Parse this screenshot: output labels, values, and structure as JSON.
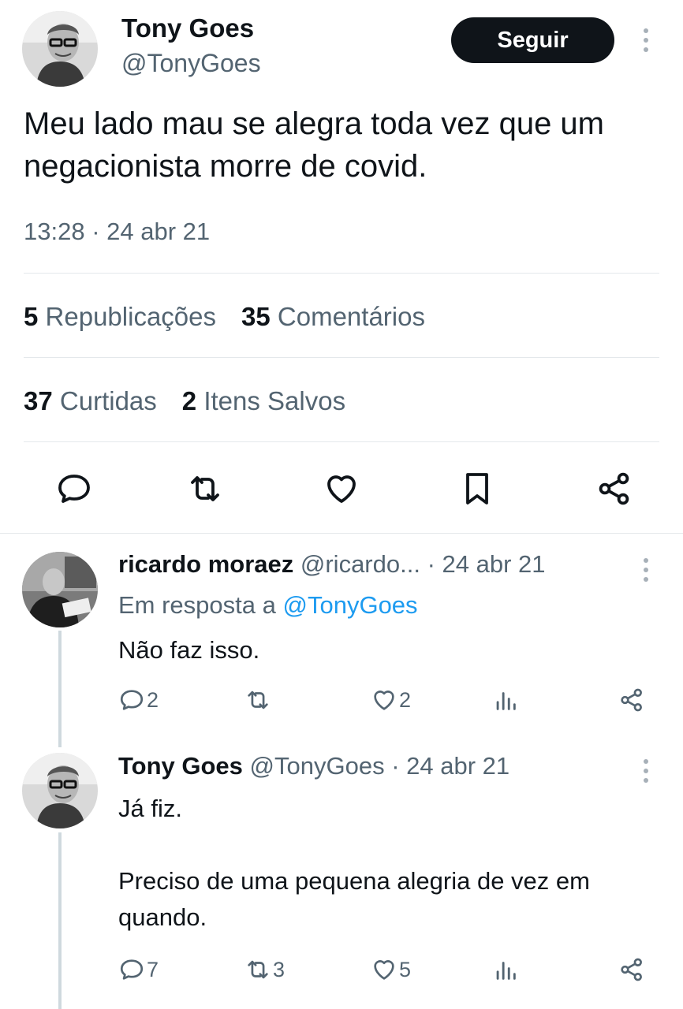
{
  "main_tweet": {
    "author_name": "Tony Goes",
    "author_handle": "@TonyGoes",
    "follow_label": "Seguir",
    "text": "Meu lado mau se alegra toda vez que um negacionista morre de covid.",
    "timestamp": "13:28 · 24 abr 21",
    "stats": {
      "reposts_count": "5",
      "reposts_label": "Republicações",
      "comments_count": "35",
      "comments_label": "Comentários",
      "likes_count": "37",
      "likes_label": "Curtidas",
      "saves_count": "2",
      "saves_label": "Itens Salvos"
    },
    "actions": [
      "reply-icon",
      "retweet-icon",
      "heart-icon",
      "bookmark-icon",
      "share-icon"
    ]
  },
  "replies": [
    {
      "name": "ricardo moraez",
      "handle": "@ricardo...",
      "date": "· 24 abr 21",
      "reply_to_label": "Em resposta a",
      "reply_to_handle": "@TonyGoes",
      "text": "Não faz isso.",
      "reply_count": "2",
      "retweet_count": "",
      "like_count": "2"
    },
    {
      "name": "Tony Goes",
      "handle": "@TonyGoes",
      "date": "· 24 abr 21",
      "text_line1": "Já fiz.",
      "text_line2": "Preciso de uma pequena alegria de vez em quando.",
      "reply_count": "7",
      "retweet_count": "3",
      "like_count": "5"
    }
  ],
  "colors": {
    "text_primary": "#0f1419",
    "text_secondary": "#536471",
    "link": "#1d9bf0",
    "divider": "#e4e8eb",
    "button_bg": "#0f1419"
  }
}
